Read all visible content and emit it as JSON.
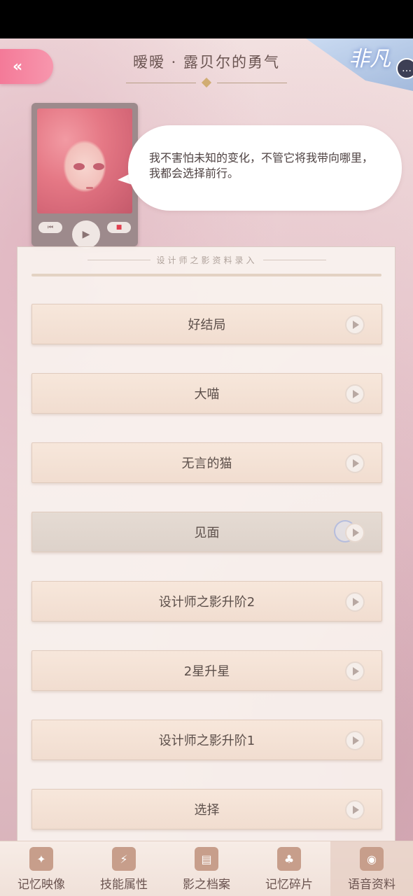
{
  "header": {
    "back_icon": "«",
    "title": "暧暧 · 露贝尔的勇气",
    "badge_text": "非凡",
    "badge_icon": "chat-bubble-icon"
  },
  "player": {
    "quote": "我不害怕未知的变化，不管它将我带向哪里，我都会选择前行。",
    "prev_symbol": "⏮",
    "play_symbol": "▶",
    "stop_symbol": "■"
  },
  "section": {
    "title": "设计师之影资料录入"
  },
  "voice_items": [
    {
      "label": "好结局"
    },
    {
      "label": "大喵"
    },
    {
      "label": "无言的猫"
    },
    {
      "label": "见面"
    },
    {
      "label": "设计师之影升阶2"
    },
    {
      "label": "2星升星"
    },
    {
      "label": "设计师之影升阶1"
    },
    {
      "label": "选择"
    }
  ],
  "tabs": [
    {
      "label": "记忆映像",
      "icon": "memory-card-icon",
      "glyph": "✦"
    },
    {
      "label": "技能属性",
      "icon": "lightning-icon",
      "glyph": "⚡"
    },
    {
      "label": "影之档案",
      "icon": "document-icon",
      "glyph": "▤"
    },
    {
      "label": "记忆碎片",
      "icon": "dress-icon",
      "glyph": "♣"
    },
    {
      "label": "语音资料",
      "icon": "voice-device-icon",
      "glyph": "◉"
    }
  ],
  "colors": {
    "back_button": "#f47a98",
    "accent_gold": "#d1ad73",
    "text_dark": "#5c4f4a"
  }
}
